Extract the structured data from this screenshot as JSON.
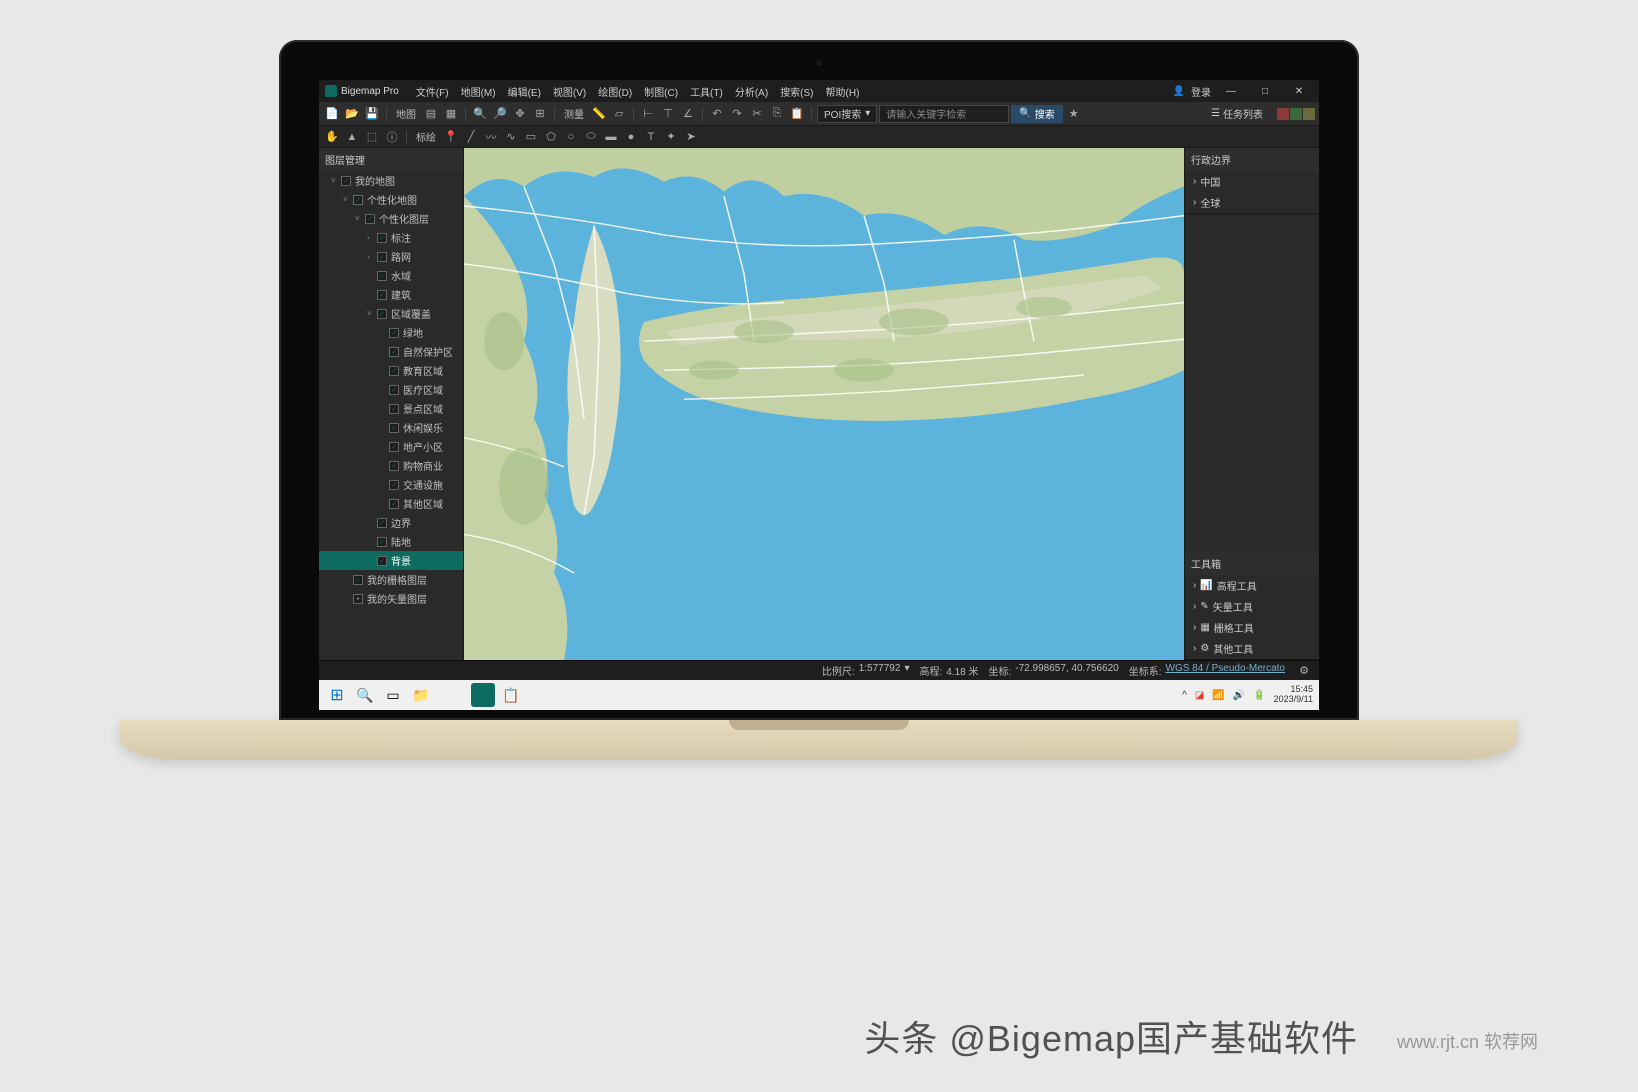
{
  "app": {
    "title": "Bigemap Pro"
  },
  "menu": [
    "文件(F)",
    "地图(M)",
    "编辑(E)",
    "视图(V)",
    "绘图(D)",
    "制图(C)",
    "工具(T)",
    "分析(A)",
    "搜索(S)",
    "帮助(H)"
  ],
  "login": "登录",
  "toolbar": {
    "map_label": "地图",
    "poi_label": "POI搜索",
    "search_placeholder": "请输入关键字检索",
    "search_btn": "搜索",
    "task_list": "任务列表",
    "label_annotate": "标绘",
    "label_measure": "测量"
  },
  "left_panel": {
    "title": "图层管理",
    "tree": [
      {
        "label": "我的地图",
        "level": 1,
        "expanded": true,
        "check": "checked"
      },
      {
        "label": "个性化地图",
        "level": 2,
        "expanded": true,
        "check": "checked"
      },
      {
        "label": "个性化图层",
        "level": 3,
        "expanded": true,
        "check": "checked"
      },
      {
        "label": "标注",
        "level": 4,
        "expanded": false,
        "check": "checked",
        "toggle": "›"
      },
      {
        "label": "路网",
        "level": 4,
        "expanded": false,
        "check": "checked",
        "toggle": "›"
      },
      {
        "label": "水域",
        "level": 4,
        "check": "checked"
      },
      {
        "label": "建筑",
        "level": 4,
        "check": "checked"
      },
      {
        "label": "区域覆盖",
        "level": 4,
        "expanded": true,
        "check": "checked",
        "toggle": "˅"
      },
      {
        "label": "绿地",
        "level": 5,
        "check": "checked"
      },
      {
        "label": "自然保护区",
        "level": 5,
        "check": "checked"
      },
      {
        "label": "教育区域",
        "level": 5,
        "check": "checked"
      },
      {
        "label": "医疗区域",
        "level": 5,
        "check": "checked"
      },
      {
        "label": "景点区域",
        "level": 5,
        "check": "checked"
      },
      {
        "label": "休闲娱乐",
        "level": 5,
        "check": "checked"
      },
      {
        "label": "地产小区",
        "level": 5,
        "check": "checked"
      },
      {
        "label": "购物商业",
        "level": 5,
        "check": "checked"
      },
      {
        "label": "交通设施",
        "level": 5,
        "check": "checked"
      },
      {
        "label": "其他区域",
        "level": 5,
        "check": "checked"
      },
      {
        "label": "边界",
        "level": 4,
        "check": "checked"
      },
      {
        "label": "陆地",
        "level": 4,
        "check": "checked"
      },
      {
        "label": "背景",
        "level": 4,
        "check": "checked",
        "selected": true
      },
      {
        "label": "我的栅格图层",
        "level": 2,
        "check": "checked"
      },
      {
        "label": "我的矢量图层",
        "level": 2,
        "check": "dot"
      }
    ]
  },
  "right_panel": {
    "section1_title": "行政边界",
    "section1": [
      "中国",
      "全球"
    ],
    "section2_title": "工具箱",
    "section2": [
      "高程工具",
      "矢量工具",
      "栅格工具",
      "其他工具"
    ]
  },
  "status": {
    "scale_label": "比例尺:",
    "scale_value": "1:577792",
    "elev_label": "高程:",
    "elev_value": "4.18 米",
    "coord_label": "坐标:",
    "coord_value": "-72.998657, 40.756620",
    "crs_label": "坐标系:",
    "crs_value": "WGS 84 / Pseudo-Mercato"
  },
  "taskbar": {
    "time": "15:45",
    "date": "2023/9/11"
  },
  "watermark": "头条 @Bigemap国产基础软件",
  "watermark2": "www.rjt.cn 软荐网"
}
